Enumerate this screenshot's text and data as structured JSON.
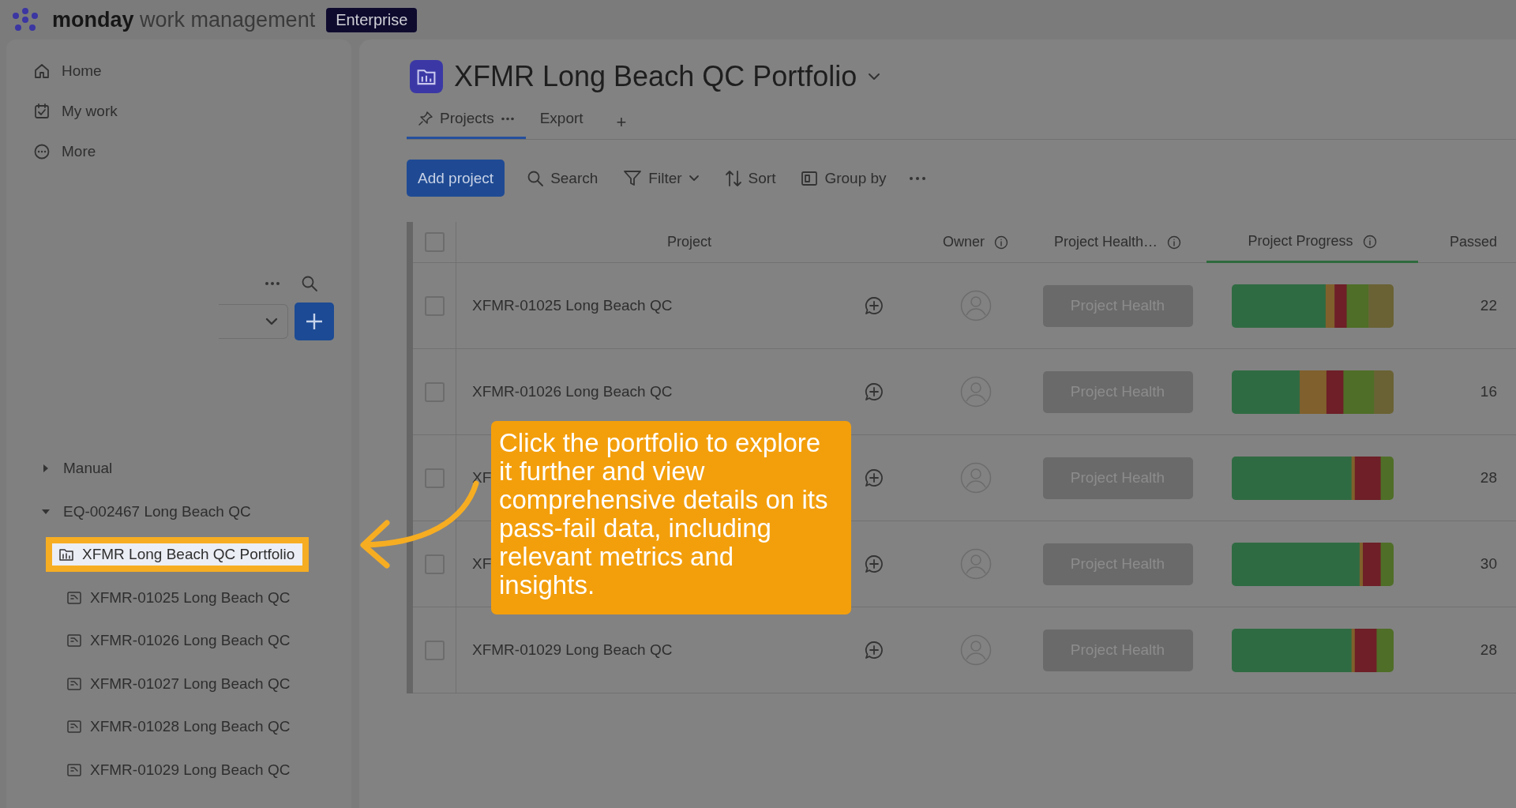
{
  "topbar": {
    "brand_bold": "monday",
    "brand_rest": "work management",
    "plan_badge": "Enterprise"
  },
  "sidebar": {
    "nav": [
      {
        "label": "Home",
        "kind": "home"
      },
      {
        "label": "My work",
        "kind": "work"
      },
      {
        "label": "More",
        "kind": "more"
      }
    ],
    "tree": [
      {
        "label": "Manual",
        "expanded": false
      },
      {
        "label": "EQ-002467 Long Beach QC",
        "expanded": true,
        "children": [
          {
            "label": "XFMR Long Beach QC Portfolio",
            "kind": "portfolio",
            "selected": true
          },
          {
            "label": "XFMR-01025 Long Beach QC",
            "kind": "board",
            "selected": false
          },
          {
            "label": "XFMR-01026 Long Beach QC",
            "kind": "board",
            "selected": false
          },
          {
            "label": "XFMR-01027 Long Beach QC",
            "kind": "board",
            "selected": false
          },
          {
            "label": "XFMR-01028 Long Beach QC",
            "kind": "board",
            "selected": false
          },
          {
            "label": "XFMR-01029 Long Beach QC",
            "kind": "board",
            "selected": false
          }
        ]
      }
    ]
  },
  "board": {
    "title": "XFMR Long Beach QC Portfolio",
    "views": [
      {
        "label": "Projects",
        "selected": true
      },
      {
        "label": "Export",
        "selected": false
      }
    ],
    "add_view": "+",
    "toolbar": {
      "primary": "Add project",
      "actions": [
        {
          "label": "Search",
          "kind": "search"
        },
        {
          "label": "Filter",
          "kind": "filter"
        },
        {
          "label": "Sort",
          "kind": "sort"
        },
        {
          "label": "Group by",
          "kind": "group"
        }
      ]
    },
    "table": {
      "select_all_checked": false,
      "columns": [
        {
          "label": "Project",
          "info": false,
          "highlighted": false
        },
        {
          "label": "Owner",
          "info": true,
          "highlighted": false
        },
        {
          "label": "Project Health…",
          "info": true,
          "highlighted": false
        },
        {
          "label": "Project Progress",
          "info": true,
          "highlighted": true
        },
        {
          "label": "Passed",
          "info": false,
          "highlighted": false
        }
      ],
      "rows": [
        {
          "project": "XFMR-01025 Long Beach QC",
          "checked": false,
          "health": "Project Health",
          "passed": "22"
        },
        {
          "project": "XFMR-01026 Long Beach QC",
          "checked": false,
          "health": "Project Health",
          "passed": "16"
        },
        {
          "project": "XF",
          "checked": false,
          "health": "Project Health",
          "passed": "28"
        },
        {
          "project": "XF",
          "checked": false,
          "health": "Project Health",
          "passed": "30"
        },
        {
          "project": "XFMR-01029 Long Beach QC",
          "checked": false,
          "health": "Project Health",
          "passed": "28"
        }
      ]
    }
  },
  "callout": {
    "text": "Click the portfolio to explore it further and view comprehensive details on its pass-fail data, including relevant metrics and insights."
  }
}
